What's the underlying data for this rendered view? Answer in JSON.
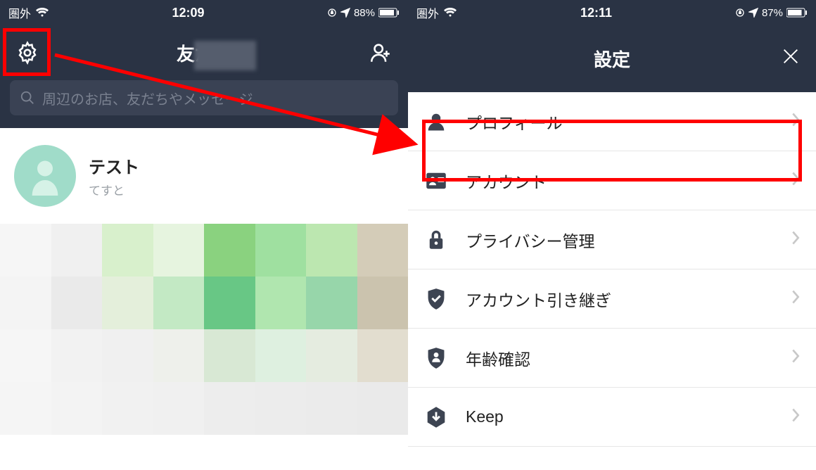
{
  "left": {
    "status": {
      "carrier": "圏外",
      "time": "12:09",
      "battery_pct": "88%"
    },
    "nav": {
      "title": "友だち"
    },
    "search": {
      "placeholder": "周辺のお店、友だちやメッセージ"
    },
    "profile": {
      "name": "テスト",
      "sub": "てすと"
    },
    "pix_colors": [
      "#f6f6f6",
      "#f0f0f0",
      "#d8f0cc",
      "#e6f4df",
      "#8ad27f",
      "#9fe0a0",
      "#bce7b0",
      "#d4ccb8",
      "#f4f4f4",
      "#eaeaea",
      "#e4efdb",
      "#c3e9c4",
      "#68c785",
      "#b0e6af",
      "#97d6aa",
      "#cbc3ae",
      "#f6f6f6",
      "#f2f2f2",
      "#f0f0f0",
      "#eef0eb",
      "#d8e8d4",
      "#def0e0",
      "#e5ece0",
      "#e2ddcf",
      "#f5f5f5",
      "#f3f3f3",
      "#f1f1f1",
      "#f0f0f0",
      "#ededed",
      "#ececec",
      "#ebebeb",
      "#eaeaea"
    ]
  },
  "right": {
    "status": {
      "carrier": "圏外",
      "time": "12:11",
      "battery_pct": "87%"
    },
    "nav": {
      "title": "設定"
    },
    "items": [
      {
        "icon": "person-icon",
        "label": "プロフィール"
      },
      {
        "icon": "id-card-icon",
        "label": "アカウント"
      },
      {
        "icon": "lock-icon",
        "label": "プライバシー管理"
      },
      {
        "icon": "shield-check-icon",
        "label": "アカウント引き継ぎ"
      },
      {
        "icon": "shield-person-icon",
        "label": "年齢確認"
      },
      {
        "icon": "arrow-down-hex-icon",
        "label": "Keep"
      }
    ]
  }
}
